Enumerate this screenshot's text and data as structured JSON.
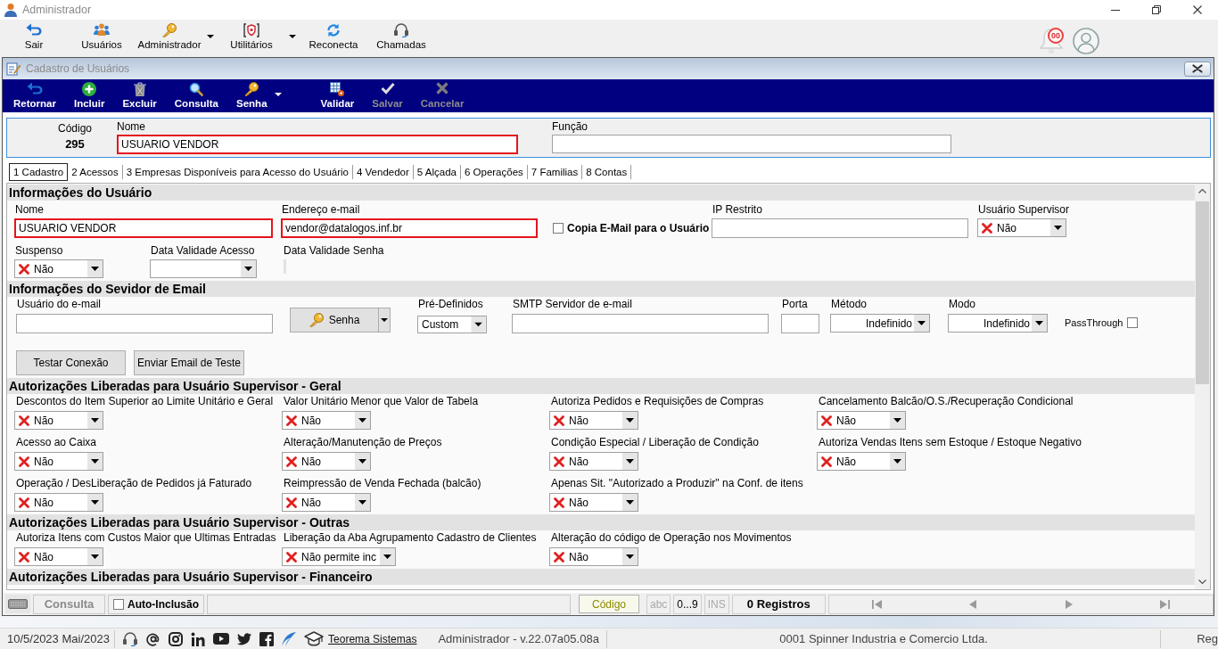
{
  "window": {
    "title": "Administrador"
  },
  "main_toolbar": [
    {
      "label": "Sair",
      "dropdown": false
    },
    {
      "label": "Usuários",
      "dropdown": false
    },
    {
      "label": "Administrador",
      "dropdown": true
    },
    {
      "label": "Utilitários",
      "dropdown": true
    },
    {
      "label": "Reconecta",
      "dropdown": false
    },
    {
      "label": "Chamadas",
      "dropdown": false
    }
  ],
  "notifications": {
    "badge": "00"
  },
  "form_window": {
    "title": "Cadastro de Usuários"
  },
  "form_toolbar": [
    {
      "label": "Retornar",
      "dropdown": false,
      "disabled": false
    },
    {
      "label": "Incluir",
      "dropdown": false,
      "disabled": false
    },
    {
      "label": "Excluir",
      "dropdown": false,
      "disabled": false
    },
    {
      "label": "Consulta",
      "dropdown": false,
      "disabled": false
    },
    {
      "label": "Senha",
      "dropdown": true,
      "disabled": false
    },
    {
      "label": "Validar",
      "dropdown": false,
      "disabled": false
    },
    {
      "label": "Salvar",
      "dropdown": false,
      "disabled": true
    },
    {
      "label": "Cancelar",
      "dropdown": false,
      "disabled": true
    }
  ],
  "header": {
    "code": {
      "label": "Código",
      "value": "295"
    },
    "name": {
      "label": "Nome",
      "value": "USUARIO VENDOR",
      "required": true
    },
    "role": {
      "label": "Função",
      "required": false
    }
  },
  "tabs": [
    {
      "label": "1 Cadastro",
      "selected": true
    },
    {
      "label": "2 Acessos",
      "selected": false
    },
    {
      "label": "3 Empresas Disponíveis para Acesso do Usuário",
      "selected": false
    },
    {
      "label": "4 Vendedor",
      "selected": false
    },
    {
      "label": "5 Alçada",
      "selected": false
    },
    {
      "label": "6 Operações",
      "selected": false
    },
    {
      "label": "7 Familias",
      "selected": false
    },
    {
      "label": "8 Contas",
      "selected": false
    }
  ],
  "user_info": {
    "title": "Informações do Usuário",
    "name": {
      "label": "Nome",
      "value": "USUARIO VENDOR",
      "required": true
    },
    "email": {
      "label": "Endereço e-mail",
      "value": "vendor@datalogos.inf.br",
      "required": true
    },
    "copy_email": {
      "label": "Copia E-Mail para o Usuário",
      "checked": false
    },
    "restricted_ip": {
      "label": "IP Restrito",
      "required": false
    },
    "supervisor": {
      "label": "Usuário Supervisor",
      "value": "Não",
      "granted": false
    },
    "suspended": {
      "label": "Suspenso",
      "value": "Não",
      "granted": false
    },
    "access_expiry": {
      "label": "Data Validade Acesso"
    },
    "password_expiry": {
      "label": "Data Validade Senha"
    }
  },
  "email_server": {
    "title": "Informações do Sevidor de Email",
    "email_user": {
      "label": "Usuário do e-mail",
      "required": false
    },
    "password_button": "Senha",
    "presets": {
      "label": "Pré-Definidos",
      "value": "Custom"
    },
    "smtp_server": {
      "label": "SMTP Servidor de e-mail",
      "required": false
    },
    "port": {
      "label": "Porta",
      "required": false
    },
    "method": {
      "label": "Método",
      "value": "Indefinido"
    },
    "mode": {
      "label": "Modo",
      "value": "Indefinido"
    },
    "passthrough": {
      "label": "PassThrough",
      "checked": false
    },
    "buttons": [
      "Testar Conexão",
      "Enviar Email de Teste"
    ]
  },
  "permission_groups": [
    {
      "title": "Autorizações Liberadas para Usuário Supervisor - Geral",
      "items": [
        {
          "label": "Descontos do Item Superior ao Limite Unitário e Geral",
          "value": "Não",
          "granted": false
        },
        {
          "label": "Valor Unitário Menor que Valor de Tabela",
          "value": "Não",
          "granted": false
        },
        {
          "label": "Autoriza Pedidos e Requisições de Compras",
          "value": "Não",
          "granted": false
        },
        {
          "label": "Cancelamento Balcão/O.S./Recuperação Condicional",
          "value": "Não",
          "granted": false
        },
        {
          "label": "Acesso ao Caixa",
          "value": "Não",
          "granted": false
        },
        {
          "label": "Alteração/Manutenção de Preços",
          "value": "Não",
          "granted": false
        },
        {
          "label": "Condição Especial / Liberação de Condição",
          "value": "Não",
          "granted": false
        },
        {
          "label": "Autoriza Vendas Itens sem Estoque / Estoque Negativo",
          "value": "Não",
          "granted": false
        },
        {
          "label": "Operação / DesLiberação de Pedidos já Faturado",
          "value": "Não",
          "granted": false
        },
        {
          "label": "Reimpressão de Venda Fechada (balcão)",
          "value": "Não",
          "granted": false
        },
        {
          "label": "Apenas Sit. \"Autorizado a Produzir\" na Conf. de itens",
          "value": "Não",
          "granted": false
        }
      ]
    },
    {
      "title": "Autorizações Liberadas para Usuário Supervisor - Outras",
      "items": [
        {
          "label": "Autoriza Itens com Custos Maior que Ultimas Entradas",
          "value": "Não",
          "granted": false
        },
        {
          "label": "Liberação da Aba Agrupamento Cadastro de Clientes",
          "value": "Não permite inc",
          "granted": false
        },
        {
          "label": "Alteração do código de Operação nos Movimentos",
          "value": "Não",
          "granted": false
        }
      ]
    },
    {
      "title": "Autorizações Liberadas para Usuário Supervisor - Financeiro"
    }
  ],
  "status_bar": {
    "mode": {
      "label": "Consulta",
      "disabled": true
    },
    "auto_include": {
      "label": "Auto-Inclusão",
      "checked": false
    },
    "search_key": {
      "label": "Código"
    },
    "indicators": [
      {
        "label": "abc",
        "on": false
      },
      {
        "label": "0...9",
        "on": true
      },
      {
        "label": "INS",
        "on": false
      }
    ],
    "records": "0 Registros"
  },
  "app_status": {
    "date": "10/5/2023 Mai/2023",
    "link": "Teorema Sistemas",
    "session": "Administrador - v.22.07a05.08a",
    "company": "0001 Spinner Industria e Comercio Ltda.",
    "column_5": "Reg"
  }
}
